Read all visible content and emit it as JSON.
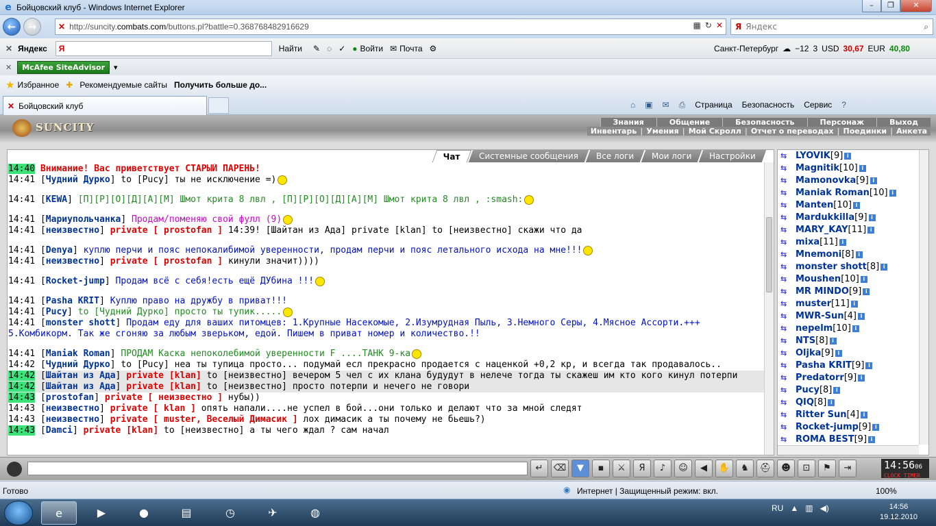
{
  "window": {
    "title": "Бойцовский клуб - Windows Internet Explorer"
  },
  "address": {
    "url_prefix": "http://suncity.",
    "url_domain": "combats.com",
    "url_suffix": "/buttons.pl?battle=0.368768482916629"
  },
  "search": {
    "placeholder": "Яндекс"
  },
  "yandex": {
    "logo": "Яндекс",
    "input": "Я",
    "find": "Найти",
    "login": "Войти",
    "mail": "Почта",
    "city": "Санкт-Петербург",
    "temp": "−12",
    "score": "3",
    "usd_label": "USD",
    "usd": "30,67",
    "eur_label": "EUR",
    "eur": "40,80"
  },
  "mcafee": {
    "label": "McAfee SiteAdvisor"
  },
  "favorites": {
    "favorites": "Избранное",
    "recommended": "Рекомендуемые сайты",
    "more": "Получить больше до..."
  },
  "tab": {
    "label": "Бойцовский клуб"
  },
  "cmd": {
    "page": "Страница",
    "security": "Безопасность",
    "service": "Сервис"
  },
  "game": {
    "logo": "SUNCITY",
    "menu1": [
      "Знания",
      "Общение",
      "Безопасность",
      "Персонаж",
      "Выход"
    ],
    "menu2": [
      "Инвентарь",
      "Умения",
      "Мой Скролл",
      "Отчет о переводах",
      "Поединки",
      "Анкета"
    ],
    "chat_tabs": [
      "Чат",
      "Системные сообщения",
      "Все логи",
      "Мои логи",
      "Настройки"
    ]
  },
  "chat": [
    {
      "time": "14:40",
      "hl": true,
      "nick": "",
      "pre": "",
      "text": "Внимание! Вас приветствует СТАРЫЙ ПАРЕНЬ!"
    },
    {
      "time": "14:41",
      "nick": "Чудний Дурко",
      "text": "to [Pucy] ты не исключение =)"
    },
    {
      "time": "14:41",
      "nick": "KEWA",
      "text": "[П][Р][О][Д][А][М] Шмот крита 8 лвл , [П][Р][О][Д][А][М] Шмот крита 8 лвл , :smash:"
    },
    {
      "time": "14:41",
      "nick": "Мариупольчанка",
      "text": "Продам/поменяю свой фулл (9)"
    },
    {
      "time": "14:41",
      "nick": "неизвестно",
      "priv": "private [ prostofan ]",
      "text": "14:39! [Шайтан из Ада] private [klan] to [неизвестно] скажи что да"
    },
    {
      "time": "14:41",
      "nick": "Denya",
      "text": "куплю перчи и пояс непокалибимой уверенности, продам перчи и пояс летального исхода на мне!!!"
    },
    {
      "time": "14:41",
      "nick": "неизвестно",
      "priv": "private [ prostofan ]",
      "text": "кинули значит))))"
    },
    {
      "time": "14:41",
      "nick": "Rocket-jump",
      "text": "Продам всё с себя!есть ещё ДУбина !!!"
    },
    {
      "time": "14:41",
      "nick": "Pasha KRIT",
      "text": "Куплю право на дружбу в приват!!!"
    },
    {
      "time": "14:41",
      "nick": "Pucy",
      "text": "to [Чудний Дурко] просто ты тупик....."
    },
    {
      "time": "14:41",
      "nick": "monster shott",
      "text": "Продам еду для ваших питомцев: 1.Крупные Насекомые, 2.Изумрудная Пыль, 3.Немного Серы, 4.Мясное Ассорти.+++ 5.Комбикорм. Так же сгоняю за любым зверьком, едой. Пишем в приват номер и количество.!!"
    },
    {
      "time": "14:41",
      "nick": "Maniak Roman",
      "text": "ПРОДАМ Каска непоколебимой уверенности F ....ТАНК 9-ка"
    },
    {
      "time": "14:42",
      "nick": "Чудний Дурко",
      "text": "to [Pucy] неа ты тупица просто... подумай есл прекрасно продается с наценкой +0,2 кр, и всегда так продавалось.."
    },
    {
      "time": "14:42",
      "hl": true,
      "nick": "Шайтан из Ада",
      "priv": "private [klan]",
      "text": "to [неизвестно] вечером 5 чел с их клана будудут в нелече тогда ты скажеш им кто кого кинул потерпи"
    },
    {
      "time": "14:42",
      "hl": true,
      "nick": "Шайтан из Ада",
      "priv": "private [klan]",
      "text": "to [неизвестно] просто потерпи и нечего не говори"
    },
    {
      "time": "14:43",
      "hl": true,
      "nick": "prostofan",
      "priv": "private [ неизвестно ]",
      "text": "нубы))"
    },
    {
      "time": "14:43",
      "nick": "неизвестно",
      "priv": "private [ klan ]",
      "text": "опять напали....не успел в бой...они только и делают что за мной следят"
    },
    {
      "time": "14:43",
      "nick": "неизвестно",
      "priv": "private [ muster, Веселый Димасик ]",
      "text": "лох димасик а ты почему не бьешь?)"
    },
    {
      "time": "14:43",
      "hl": true,
      "nick": "Damci",
      "priv": "private [klan]",
      "text": "to [неизвестно] а ты чего ждал ? сам начал"
    }
  ],
  "users": [
    {
      "name": "LYOVIK",
      "lvl": "[9]"
    },
    {
      "name": "Magnitik",
      "lvl": "[10]"
    },
    {
      "name": "Mamonovka",
      "lvl": "[9]"
    },
    {
      "name": "Maniak Roman",
      "lvl": "[10]"
    },
    {
      "name": "Manten",
      "lvl": "[10]"
    },
    {
      "name": "Mardukkilla",
      "lvl": "[9]"
    },
    {
      "name": "MARY_KAY",
      "lvl": "[11]"
    },
    {
      "name": "mixa",
      "lvl": "[11]"
    },
    {
      "name": "Mnemoni",
      "lvl": "[8]"
    },
    {
      "name": "monster shott",
      "lvl": "[8]"
    },
    {
      "name": "Moushen",
      "lvl": "[10]"
    },
    {
      "name": "MR MINDO",
      "lvl": "[9]"
    },
    {
      "name": "muster",
      "lvl": "[11]"
    },
    {
      "name": "MWR-Sun",
      "lvl": "[4]"
    },
    {
      "name": "nepelm",
      "lvl": "[10]"
    },
    {
      "name": "NTS",
      "lvl": "[8]"
    },
    {
      "name": "Oljka",
      "lvl": "[9]"
    },
    {
      "name": "Pasha KRIT",
      "lvl": "[9]"
    },
    {
      "name": "Predatorr",
      "lvl": "[9]"
    },
    {
      "name": "Pucy",
      "lvl": "[8]"
    },
    {
      "name": "QIQ",
      "lvl": "[8]"
    },
    {
      "name": "Ritter Sun",
      "lvl": "[4]"
    },
    {
      "name": "Rocket-jump",
      "lvl": "[9]"
    },
    {
      "name": "ROMA BEST",
      "lvl": "[9]"
    }
  ],
  "clock": {
    "time": "14:56",
    "sec": "06",
    "label": "CLOCK TIMER"
  },
  "status": {
    "ready": "Готово",
    "zone": "Интернет | Защищенный режим: вкл.",
    "zoom": "100%"
  },
  "taskbar": {
    "lang": "RU",
    "time": "14:56",
    "date": "19.12.2010"
  }
}
